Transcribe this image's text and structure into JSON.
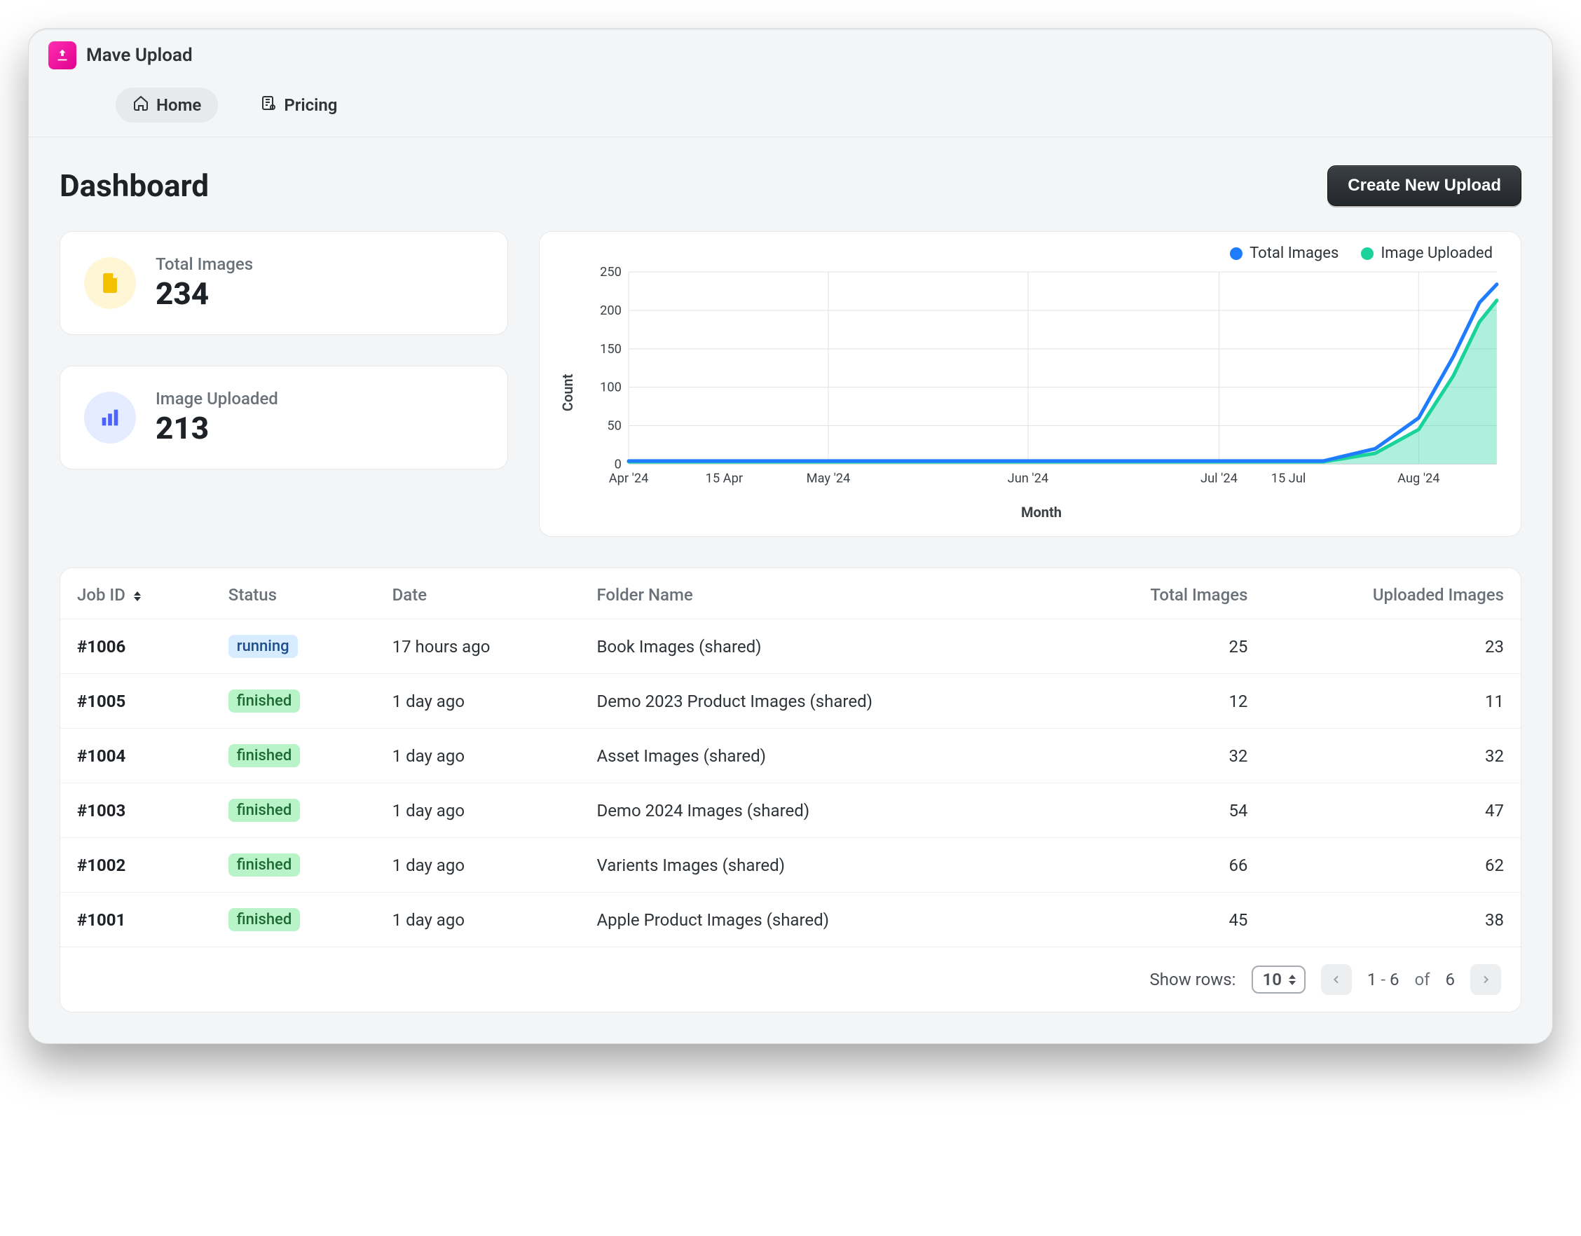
{
  "brand": {
    "name": "Mave Upload"
  },
  "nav": {
    "home": "Home",
    "pricing": "Pricing"
  },
  "header": {
    "title": "Dashboard",
    "create_button": "Create New Upload"
  },
  "stats": {
    "total_images": {
      "label": "Total Images",
      "value": "234"
    },
    "uploaded": {
      "label": "Image Uploaded",
      "value": "213"
    }
  },
  "chart_data": {
    "type": "line",
    "xlabel": "Month",
    "ylabel": "Count",
    "ylim": [
      0,
      250
    ],
    "yticks": [
      0,
      50,
      100,
      150,
      200,
      250
    ],
    "x_tick_labels": [
      "Apr '24",
      "15 Apr",
      "May '24",
      "Jun '24",
      "Jul '24",
      "15 Jul",
      "Aug '24"
    ],
    "x_tick_positions": [
      0.0,
      0.11,
      0.23,
      0.46,
      0.68,
      0.76,
      0.91
    ],
    "legend": [
      {
        "name": "Total Images",
        "color": "#1f7cff"
      },
      {
        "name": "Image Uploaded",
        "color": "#19d39b"
      }
    ],
    "series": [
      {
        "name": "Total Images",
        "color": "#1f7cff",
        "area": false,
        "points": [
          [
            0.0,
            4
          ],
          [
            0.8,
            4
          ],
          [
            0.86,
            20
          ],
          [
            0.91,
            60
          ],
          [
            0.95,
            140
          ],
          [
            0.98,
            210
          ],
          [
            1.0,
            234
          ]
        ]
      },
      {
        "name": "Image Uploaded",
        "color": "#19d39b",
        "area": true,
        "points": [
          [
            0.0,
            3
          ],
          [
            0.8,
            3
          ],
          [
            0.86,
            14
          ],
          [
            0.91,
            45
          ],
          [
            0.95,
            115
          ],
          [
            0.98,
            185
          ],
          [
            1.0,
            213
          ]
        ]
      }
    ]
  },
  "table": {
    "columns": {
      "job_id": "Job ID",
      "status": "Status",
      "date": "Date",
      "folder": "Folder Name",
      "total": "Total Images",
      "uploaded": "Uploaded Images"
    },
    "rows": [
      {
        "id": "#1006",
        "status": "running",
        "date": "17 hours ago",
        "folder": "Book Images (shared)",
        "total": "25",
        "uploaded": "23"
      },
      {
        "id": "#1005",
        "status": "finished",
        "date": "1 day ago",
        "folder": "Demo 2023 Product Images (shared)",
        "total": "12",
        "uploaded": "11"
      },
      {
        "id": "#1004",
        "status": "finished",
        "date": "1 day ago",
        "folder": "Asset Images (shared)",
        "total": "32",
        "uploaded": "32"
      },
      {
        "id": "#1003",
        "status": "finished",
        "date": "1 day ago",
        "folder": "Demo 2024 Images (shared)",
        "total": "54",
        "uploaded": "47"
      },
      {
        "id": "#1002",
        "status": "finished",
        "date": "1 day ago",
        "folder": "Varients Images (shared)",
        "total": "66",
        "uploaded": "62"
      },
      {
        "id": "#1001",
        "status": "finished",
        "date": "1 day ago",
        "folder": "Apple Product Images (shared)",
        "total": "45",
        "uploaded": "38"
      }
    ]
  },
  "pagination": {
    "show_rows_label": "Show rows:",
    "rows_value": "10",
    "range_start": "1",
    "range_end": "6",
    "of_label": "of",
    "total": "6"
  }
}
